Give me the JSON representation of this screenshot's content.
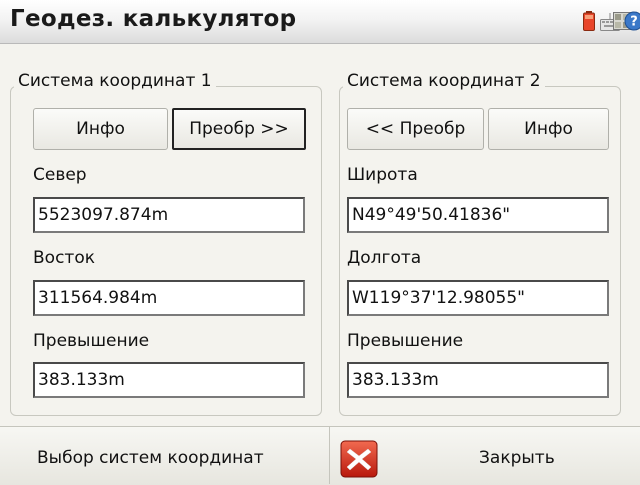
{
  "app": {
    "title": "Геодез. калькулятор",
    "status_icons": [
      "battery-icon",
      "keyboard-icon",
      "grid-icon",
      "help-icon"
    ]
  },
  "system1": {
    "group_label": "Система координат 1",
    "info_button": "Инфо",
    "convert_button": "Преобр >>",
    "fields": [
      {
        "label": "Север",
        "value": "5523097.874m"
      },
      {
        "label": "Восток",
        "value": "311564.984m"
      },
      {
        "label": "Превышение",
        "value": "383.133m"
      }
    ]
  },
  "system2": {
    "group_label": "Система координат 2",
    "convert_button": "<< Преобр",
    "info_button": "Инфо",
    "fields": [
      {
        "label": "Широта",
        "value": "N49°49'50.41836\""
      },
      {
        "label": "Долгота",
        "value": "W119°37'12.98055\""
      },
      {
        "label": "Превышение",
        "value": "383.133m"
      }
    ]
  },
  "bottom": {
    "select_systems": "Выбор систем координат",
    "close": "Закрыть"
  },
  "colors": {
    "background": "#f4f3ee",
    "close_icon_red": "#d42a1c"
  }
}
